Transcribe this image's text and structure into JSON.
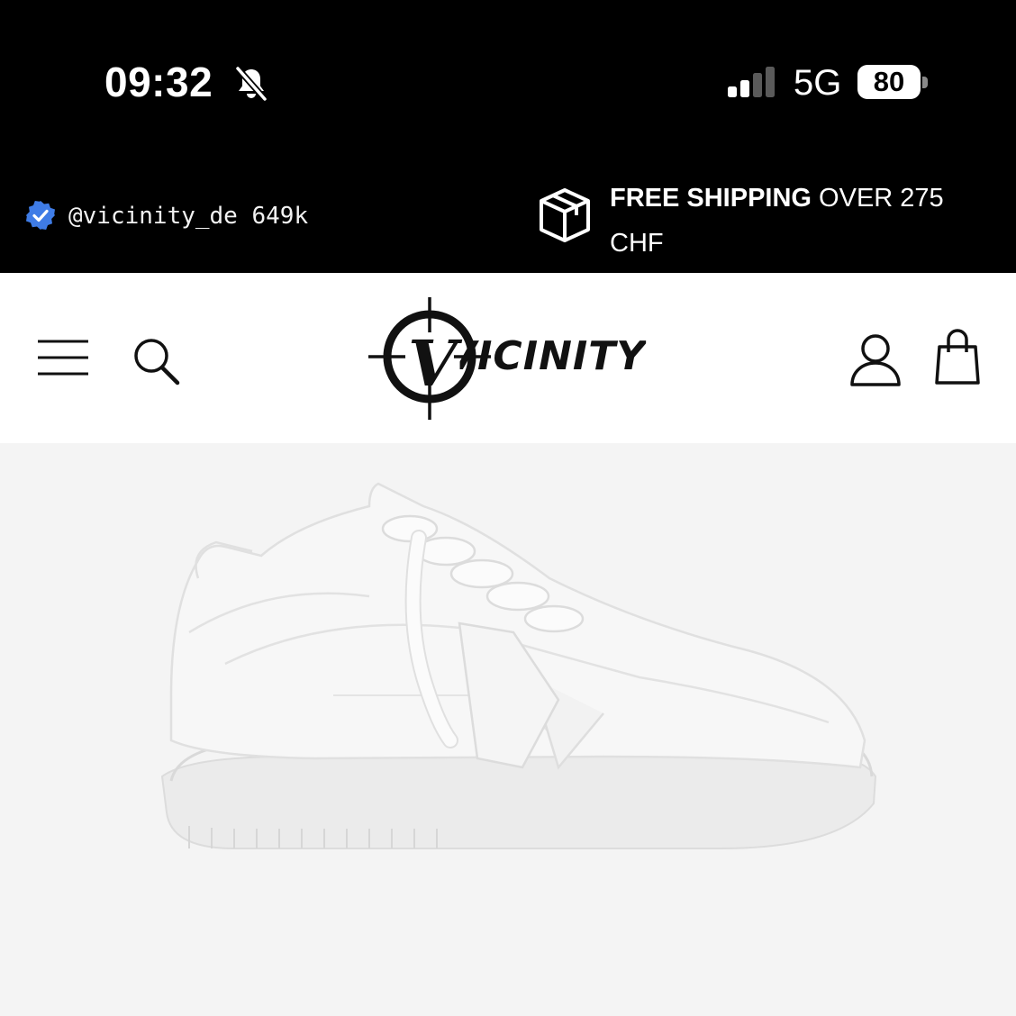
{
  "status_bar": {
    "time": "09:32",
    "network": "5G",
    "battery": "80",
    "icons": [
      "bell-slash-icon",
      "signal-icon",
      "battery-icon"
    ]
  },
  "promo_bar": {
    "social_handle": "@vicinity_de 649k",
    "shipping_bold": "FREE SHIPPING",
    "shipping_rest": " OVER 275 CHF",
    "icons": [
      "verified-badge-icon",
      "package-box-icon"
    ],
    "verified_color": "#3f7ce6"
  },
  "header": {
    "brand": "VICINITY",
    "icons": [
      "hamburger-menu-icon",
      "search-icon",
      "account-icon",
      "shopping-bag-icon"
    ]
  },
  "product": {
    "image": "white-low-top-sneaker-photo"
  },
  "colors": {
    "bar_background": "#000000",
    "header_background": "#ffffff",
    "hero_background": "#f4f4f4"
  }
}
